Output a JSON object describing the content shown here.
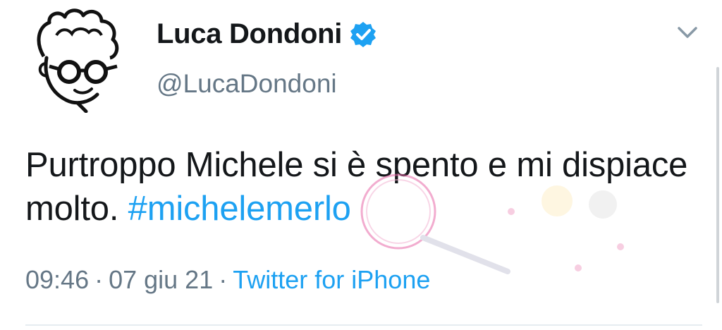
{
  "tweet": {
    "display_name": "Luca Dondoni",
    "handle": "@LucaDondoni",
    "text_before": "Purtroppo Michele si è spento e mi dispiace molto. ",
    "hashtag": "#michelemerlo",
    "time": "09:46",
    "date": "07 giu 21",
    "separator": "·",
    "source": "Twitter for iPhone"
  },
  "icons": {
    "verified": "verified-badge-icon",
    "menu": "chevron-down-icon"
  },
  "colors": {
    "primary_text": "#14171a",
    "secondary_text": "#657786",
    "link": "#1da1f2",
    "verified": "#1da1f2"
  }
}
